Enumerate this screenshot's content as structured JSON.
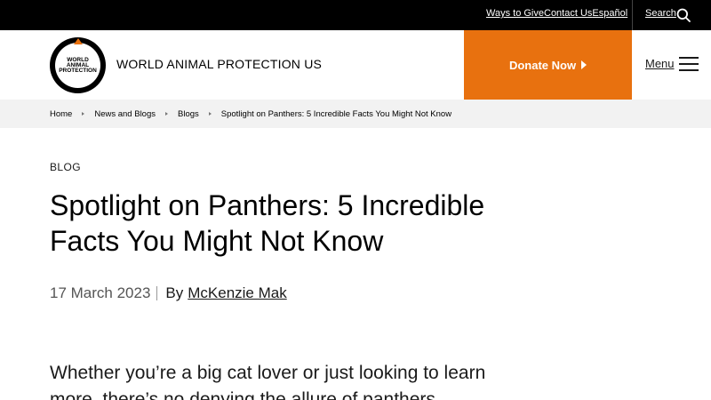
{
  "topbar": {
    "links": [
      "Ways to Give",
      "Contact Us",
      "Español"
    ],
    "search_label": "Search"
  },
  "header": {
    "logo_lines": [
      "WORLD",
      "ANIMAL",
      "PROTECTION"
    ],
    "brand_name": "WORLD ANIMAL PROTECTION US",
    "donate_label": "Donate Now",
    "menu_label": "Menu"
  },
  "breadcrumb": [
    "Home",
    "News and Blogs",
    "Blogs",
    "Spotlight on Panthers: 5 Incredible Facts You Might Not Know"
  ],
  "article": {
    "kicker": "BLOG",
    "title": "Spotlight on Panthers: 5 Incredible Facts You Might Not Know",
    "date": "17 March 2023",
    "by": "By",
    "author": "McKenzie Mak",
    "lede": "Whether you’re a big cat lover or just looking to learn more, there’s no denying the allure of panthers."
  },
  "colors": {
    "accent": "#e8710f",
    "topbar": "#000000",
    "breadcrumb_bg": "#f2f2f2"
  }
}
